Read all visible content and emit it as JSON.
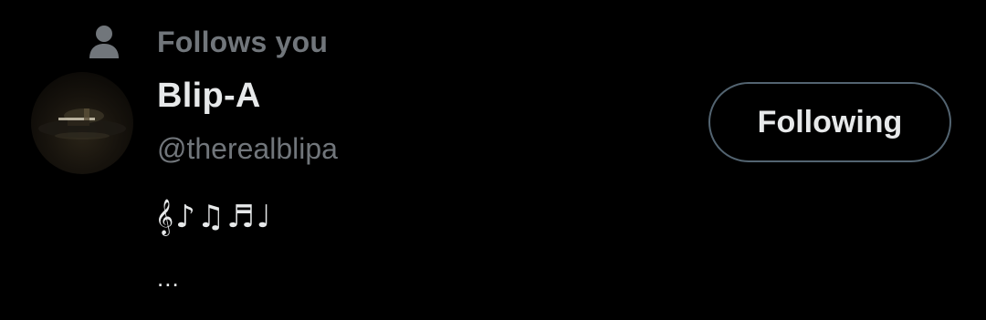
{
  "social_context": {
    "icon": "person-icon",
    "text": "Follows you"
  },
  "user": {
    "avatar": "avatar",
    "display_name": "Blip-A",
    "handle": "@therealblipa",
    "bio": "𝄞♪♫♬♩",
    "bio_more": "..."
  },
  "follow_button": {
    "label": "Following"
  },
  "colors": {
    "background": "#000000",
    "primary_text": "#e7e9ea",
    "secondary_text": "#71767b",
    "button_border": "#536471"
  }
}
